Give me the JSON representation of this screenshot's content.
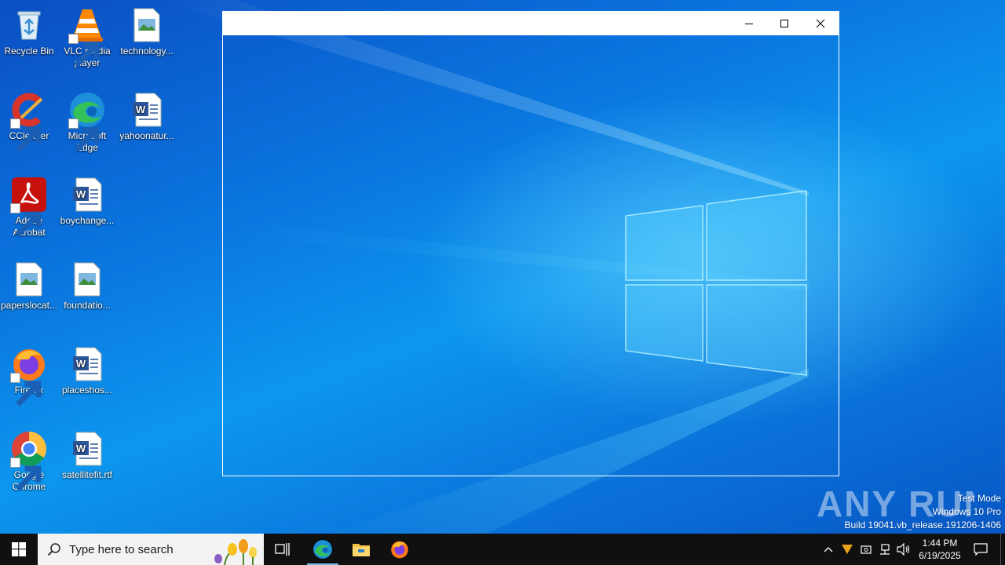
{
  "desktop": {
    "icons": [
      {
        "label": "Recycle Bin",
        "icon": "recycle-bin-icon"
      },
      {
        "label": "VLC media player",
        "icon": "vlc-icon"
      },
      {
        "label": "technology...",
        "icon": "image-file-icon"
      },
      {
        "label": "CCleaner",
        "icon": "ccleaner-icon"
      },
      {
        "label": "Microsoft Edge",
        "icon": "edge-icon"
      },
      {
        "label": "yahoonatur...",
        "icon": "word-document-icon"
      },
      {
        "label": "Adobe Acrobat",
        "icon": "acrobat-icon"
      },
      {
        "label": "boychange...",
        "icon": "word-document-icon"
      },
      {
        "label": "paperslocat...",
        "icon": "image-file-icon"
      },
      {
        "label": "foundatio...",
        "icon": "image-file-icon"
      },
      {
        "label": "Firefox",
        "icon": "firefox-icon"
      },
      {
        "label": "placeshos...",
        "icon": "word-document-icon"
      },
      {
        "label": "Google Chrome",
        "icon": "chrome-icon"
      },
      {
        "label": "satellitefit.rtf",
        "icon": "word-document-icon"
      }
    ]
  },
  "window": {
    "controls": [
      "minimize",
      "maximize",
      "close"
    ]
  },
  "watermark": {
    "brand": "ANY RUN",
    "line1": "Test Mode",
    "line2": "Windows 10 Pro",
    "line3": "Build 19041.vb_release.191206-1406"
  },
  "taskbar": {
    "search_placeholder": "Type here to search",
    "time": "1:44 PM",
    "date": "6/19/2025",
    "pinned": [
      "task-view-icon",
      "edge-icon",
      "file-explorer-icon",
      "firefox-icon"
    ]
  }
}
